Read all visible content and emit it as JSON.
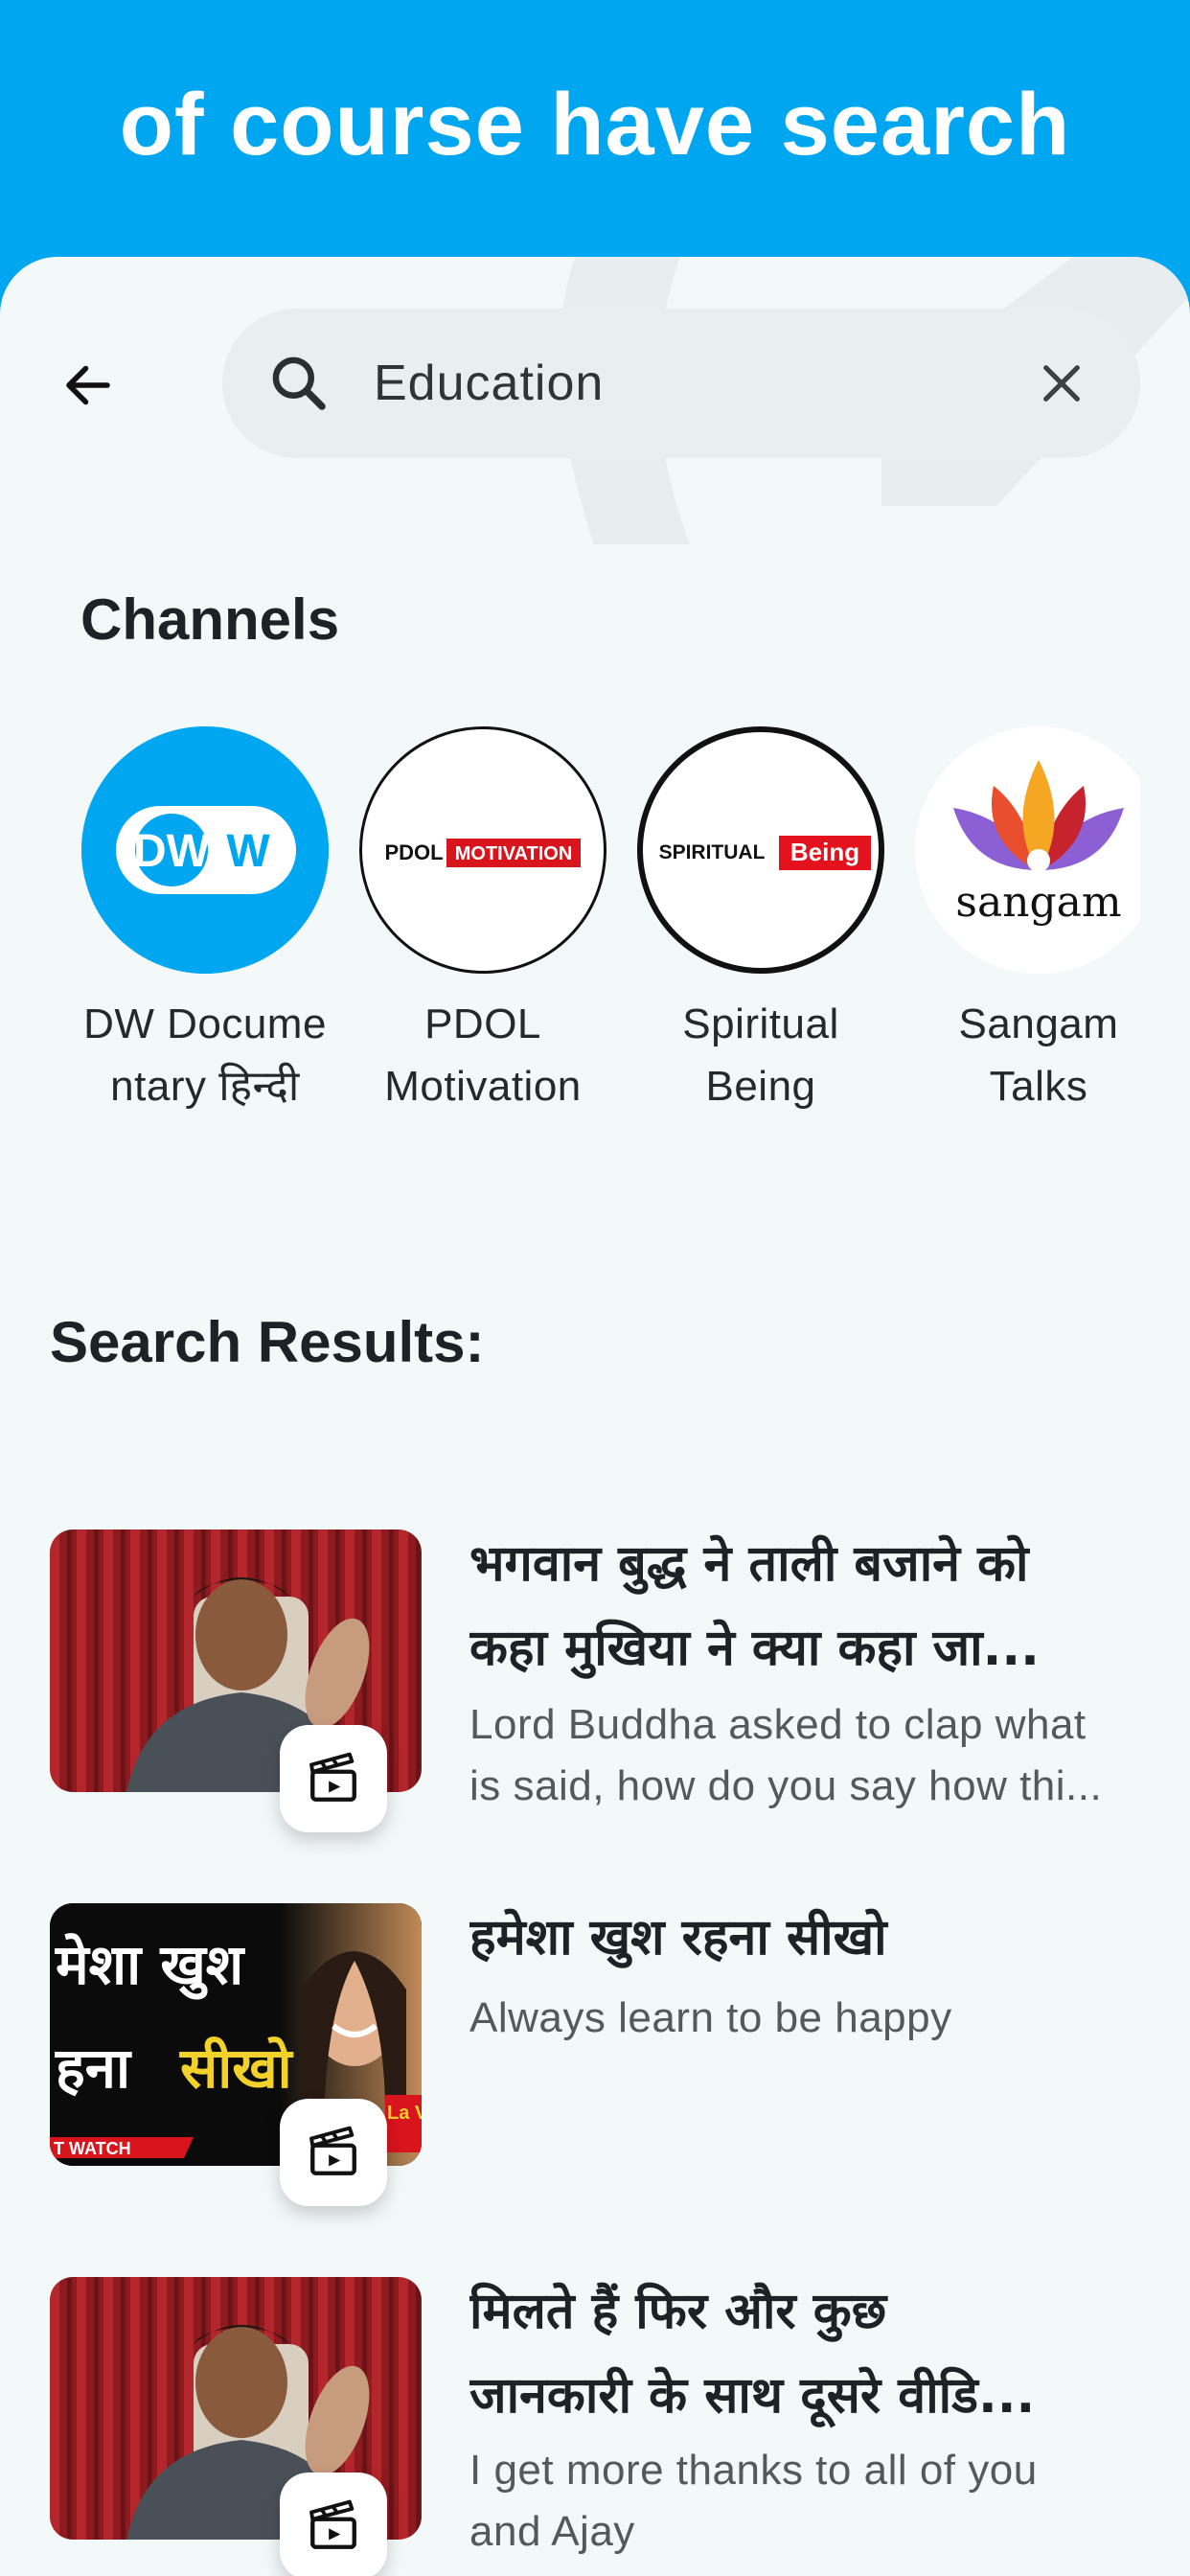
{
  "banner": {
    "title": "of course have search"
  },
  "search": {
    "value": "Education"
  },
  "channels": {
    "title": "Channels",
    "items": [
      {
        "name_line1": "DW Docume",
        "name_line2": "ntary हिन्दी",
        "logo": "DW"
      },
      {
        "name_line1": "PDOL",
        "name_line2": "Motivation",
        "logo_text1": "PDOL",
        "logo_text2": "MOTIVATION"
      },
      {
        "name_line1": "Spiritual",
        "name_line2": "Being",
        "logo_text1": "SPIRITUAL",
        "logo_text2": "Being"
      },
      {
        "name_line1": "Sangam",
        "name_line2": "Talks",
        "logo_text": "sangam"
      }
    ]
  },
  "results": {
    "title": "Search Results:",
    "items": [
      {
        "title_line1": "भगवान बुद्ध ने ताली बजाने को",
        "title_line2": "कहा मुखिया ने क्या कहा जा...",
        "desc_line1": "Lord Buddha asked to clap what",
        "desc_line2": "is said, how do you say how thi..."
      },
      {
        "title_line1": "हमेशा खुश रहना सीखो",
        "desc_line1": "Always learn to be happy",
        "thumb_line1": "मेशा खुश",
        "thumb_line2a": "हना ",
        "thumb_line2b": "सीखो",
        "thumb_tag": "T WATCH",
        "thumb_side": "La VI"
      },
      {
        "title_line1": "मिलते हैं फिर और कुछ",
        "title_line2": "जानकारी के साथ दूसरे वीडि...",
        "desc_line1": "I get more thanks to all of you",
        "desc_line2": "and Ajay"
      }
    ]
  },
  "colors": {
    "banner": "#00a7f0",
    "page": "#f3f8f9",
    "search_bg": "#e9eef0"
  },
  "icons": {
    "back": "arrow-left-icon",
    "search": "search-icon",
    "clear": "close-icon",
    "clip": "clapperboard-icon"
  }
}
